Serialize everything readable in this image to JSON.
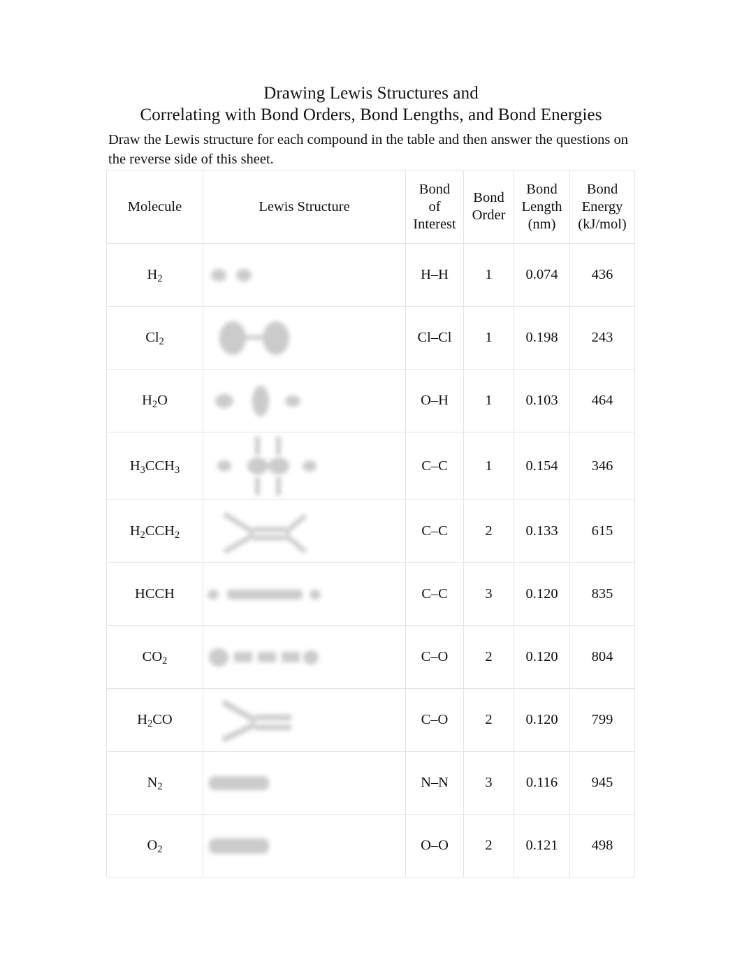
{
  "document": {
    "title_lines": [
      "Drawing Lewis Structures and",
      "Correlating with Bond Orders, Bond Lengths, and Bond Energies"
    ],
    "instructions": "Draw the Lewis structure for each compound in the table and then answer the questions on the reverse side of this sheet.",
    "background_color": "#ffffff",
    "text_color": "#111111",
    "border_color": "#e4e4e4"
  },
  "table": {
    "headers": {
      "molecule": [
        "Molecule"
      ],
      "lewis_structure": [
        "Lewis Structure"
      ],
      "bond_of_interest": [
        "Bond",
        "of",
        "Interest"
      ],
      "bond_order": [
        "Bond",
        "Order"
      ],
      "bond_length": [
        "Bond",
        "Length",
        "(nm)"
      ],
      "bond_energy": [
        "Bond",
        "Energy",
        "(kJ/mol)"
      ]
    },
    "rows": [
      {
        "molecule_html": "H<sub>2</sub>",
        "molecule_text": "H2",
        "lewis_structure": "",
        "bond_of_interest": "H–H",
        "bond_order": "1",
        "bond_length": "0.074",
        "bond_energy": "436"
      },
      {
        "molecule_html": "Cl<sub>2</sub>",
        "molecule_text": "Cl2",
        "lewis_structure": "",
        "bond_of_interest": "Cl–Cl",
        "bond_order": "1",
        "bond_length": "0.198",
        "bond_energy": "243"
      },
      {
        "molecule_html": "H<sub>2</sub>O",
        "molecule_text": "H2O",
        "lewis_structure": "",
        "bond_of_interest": "O–H",
        "bond_order": "1",
        "bond_length": "0.103",
        "bond_energy": "464"
      },
      {
        "molecule_html": "H<sub>3</sub>CCH<sub>3</sub>",
        "molecule_text": "H3CCH3",
        "lewis_structure": "",
        "bond_of_interest": "C–C",
        "bond_order": "1",
        "bond_length": "0.154",
        "bond_energy": "346"
      },
      {
        "molecule_html": "H<sub>2</sub>CCH<sub>2</sub>",
        "molecule_text": "H2CCH2",
        "lewis_structure": "",
        "bond_of_interest": "C–C",
        "bond_order": "2",
        "bond_length": "0.133",
        "bond_energy": "615"
      },
      {
        "molecule_html": "HCCH",
        "molecule_text": "HCCH",
        "lewis_structure": "",
        "bond_of_interest": "C–C",
        "bond_order": "3",
        "bond_length": "0.120",
        "bond_energy": "835"
      },
      {
        "molecule_html": "CO<sub>2</sub>",
        "molecule_text": "CO2",
        "lewis_structure": "",
        "bond_of_interest": "C–O",
        "bond_order": "2",
        "bond_length": "0.120",
        "bond_energy": "804"
      },
      {
        "molecule_html": "H<sub>2</sub>CO",
        "molecule_text": "H2CO",
        "lewis_structure": "",
        "bond_of_interest": "C–O",
        "bond_order": "2",
        "bond_length": "0.120",
        "bond_energy": "799"
      },
      {
        "molecule_html": "N<sub>2</sub>",
        "molecule_text": "N2",
        "lewis_structure": "",
        "bond_of_interest": "N–N",
        "bond_order": "3",
        "bond_length": "0.116",
        "bond_energy": "945"
      },
      {
        "molecule_html": "O<sub>2</sub>",
        "molecule_text": "O2",
        "lewis_structure": "",
        "bond_of_interest": "O–O",
        "bond_order": "2",
        "bond_length": "0.121",
        "bond_energy": "498"
      }
    ]
  }
}
